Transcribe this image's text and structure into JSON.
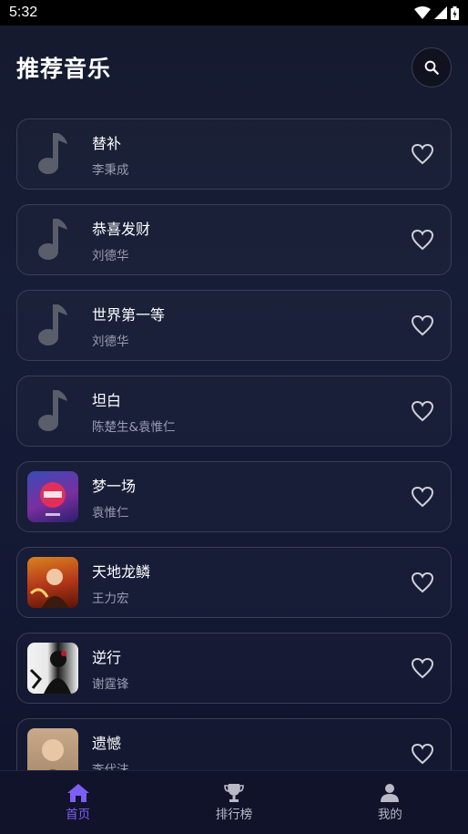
{
  "status_bar": {
    "time": "5:32"
  },
  "header": {
    "title": "推荐音乐"
  },
  "songs": [
    {
      "title": "替补",
      "artist": "李秉成",
      "cover": "note-icon"
    },
    {
      "title": "恭喜发财",
      "artist": "刘德华",
      "cover": "note-icon"
    },
    {
      "title": "世界第一等",
      "artist": "刘德华",
      "cover": "note-icon"
    },
    {
      "title": "坦白",
      "artist": "陈楚生&袁惟仁",
      "cover": "note-icon"
    },
    {
      "title": "梦一场",
      "artist": "袁惟仁",
      "cover": "album-cover"
    },
    {
      "title": "天地龙鳞",
      "artist": "王力宏",
      "cover": "album-cover"
    },
    {
      "title": "逆行",
      "artist": "谢霆锋",
      "cover": "album-cover"
    },
    {
      "title": "遗憾",
      "artist": "李代沫",
      "cover": "album-cover"
    }
  ],
  "bottom_nav": [
    {
      "label": "首页",
      "icon": "home-icon",
      "active": true
    },
    {
      "label": "排行榜",
      "icon": "trophy-icon",
      "active": false
    },
    {
      "label": "我的",
      "icon": "person-icon",
      "active": false
    }
  ],
  "colors": {
    "accent": "#7e5ff5",
    "background": "#161d36"
  }
}
